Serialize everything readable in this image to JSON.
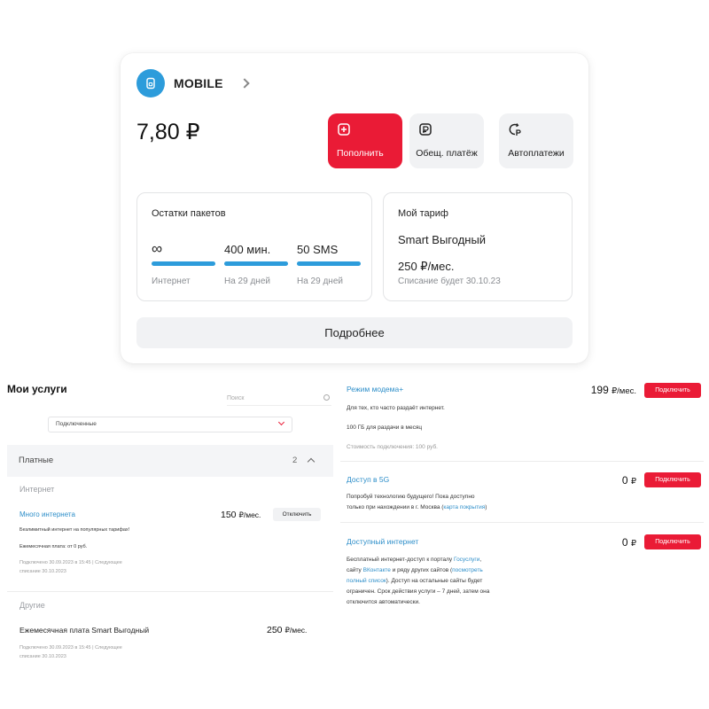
{
  "account": {
    "name": "MOBILE",
    "balance": "7,80 ₽",
    "actions": [
      {
        "label": "Пополнить",
        "icon": "plus-square-icon"
      },
      {
        "label": "Обещ. платёж",
        "icon": "promised-payment-icon"
      },
      {
        "label": "Автоплатежи",
        "icon": "autopay-icon"
      }
    ],
    "packages": {
      "title": "Остатки пакетов",
      "items": [
        {
          "value": "∞",
          "sub": "Интернет",
          "remaining": 1.0
        },
        {
          "value": "400 мин.",
          "sub": "На 29 дней",
          "remaining": 1.0
        },
        {
          "value": "50 SMS",
          "sub": "На 29 дней",
          "remaining": 1.0
        }
      ]
    },
    "tariff": {
      "title": "Мой тариф",
      "name": "Smart Выгодный",
      "price": "250 ₽/мес.",
      "note": "Списание будет 30.10.23"
    },
    "more_label": "Подробнее"
  },
  "services": {
    "title": "Мои услуги",
    "search_placeholder": "Поиск",
    "filter_value": "Подключенные",
    "paid": {
      "label": "Платные",
      "count": "2"
    },
    "groups": [
      {
        "label": "Интернет",
        "item": {
          "name": "Много интернета",
          "price": "150",
          "unit": "₽/мес.",
          "button": "Отключить",
          "desc": "Безлимитный интернет на популярных тарифах!",
          "fee": "Ежемесячная плата: от 0 руб.",
          "meta1": "Подключено 30.09.2023 в 15:45 | Следующее",
          "meta2": "списание 30.10.2023"
        }
      },
      {
        "label": "Другие",
        "item": {
          "name": "Ежемесячная плата Smart Выгодный",
          "price": "250",
          "unit": "₽/мес.",
          "meta1": "Подключено 30.09.2023 в 15:45 | Следующее",
          "meta2": "списание 30.10.2023"
        }
      }
    ]
  },
  "available": [
    {
      "name": "Режим модема+",
      "price": "199",
      "unit": "₽/мес.",
      "button": "Подключить",
      "line1": "Для тех, кто часто раздаёт интернет.",
      "line2": "100 ГБ для раздачи в месяц",
      "line3": "Стоимость подключения: 100 руб."
    },
    {
      "name": "Доступ в 5G",
      "price": "0",
      "unit": "₽",
      "button": "Подключить",
      "line1": "Попробуй технологию будущего! Пока доступно",
      "line2a": "только при нахождении в г. Москва (",
      "line2link": "карта покрытия",
      "line2b": ")"
    },
    {
      "name": "Доступный интернет",
      "price": "0",
      "unit": "₽",
      "button": "Подключить",
      "l1a": "Бесплатный интернет-доступ к порталу ",
      "l1link": "Госуслуги",
      "l1b": ",",
      "l2a": "сайту ",
      "l2link1": "ВКонтакте",
      "l2b": " и ряду других сайтов (",
      "l2link2": "посмотреть",
      "l3link": "полный список",
      "l3b": "). Доступ на остальные сайты будет",
      "l4": "ограничен. Срок действия услуги – 7 дней, затем она",
      "l5": "отключится автоматически."
    }
  ],
  "colors": {
    "accent": "#ea1b36",
    "blue": "#2d9cdb",
    "link": "#2d8ec9"
  }
}
